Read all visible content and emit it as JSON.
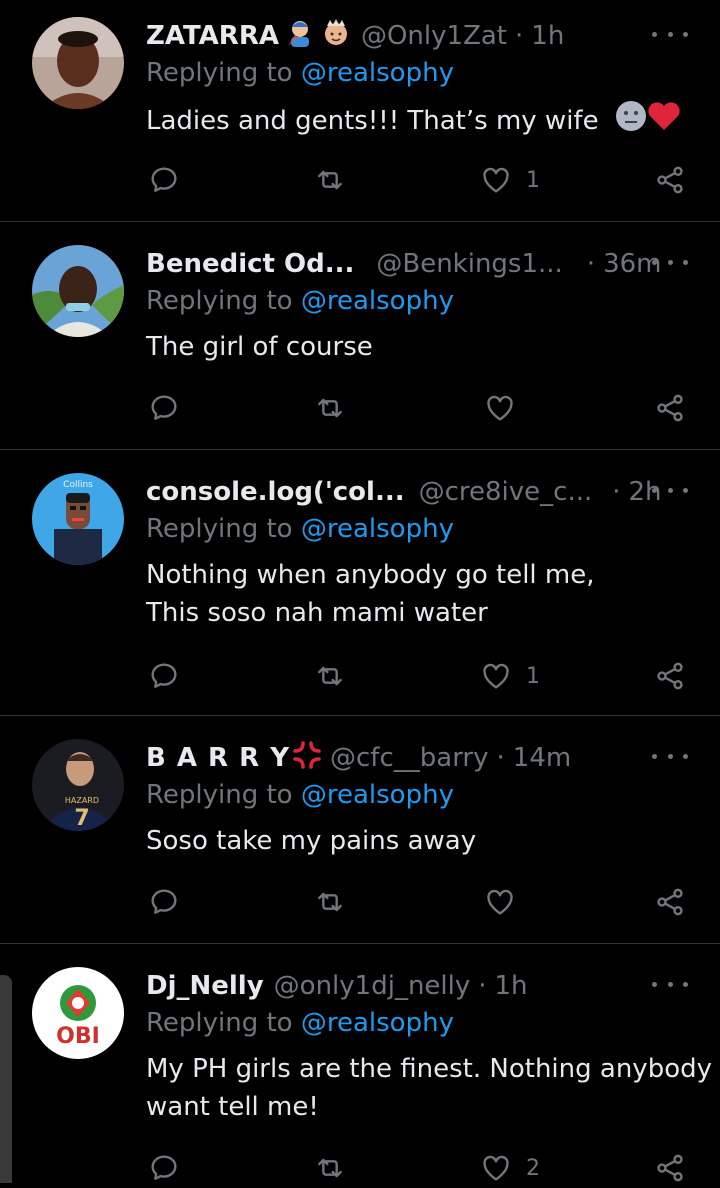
{
  "replying_label": "Replying to ",
  "tweets": [
    {
      "name": "ZATARRA",
      "handle": "@Only1Zat",
      "time": "1h",
      "mention": "@realsophy",
      "lines": [
        "Ladies and gents!!! That’s my wife"
      ],
      "likes": "1"
    },
    {
      "name": "Benedict Od...",
      "handle": "@Benkings1...",
      "time": "36m",
      "mention": "@realsophy",
      "lines": [
        "The girl of course"
      ],
      "likes": ""
    },
    {
      "name": "console.log('col...",
      "handle": "@cre8ive_c...",
      "time": "2h",
      "mention": "@realsophy",
      "lines": [
        "Nothing when anybody go tell me,",
        "This soso nah mami water"
      ],
      "likes": "1"
    },
    {
      "name": "B A R R Y",
      "handle": "@cfc__barry",
      "time": "14m",
      "mention": "@realsophy",
      "lines": [
        "Soso take my pains away"
      ],
      "likes": ""
    },
    {
      "name": "Dj_Nelly",
      "handle": "@only1dj_nelly",
      "time": "1h",
      "mention": "@realsophy",
      "lines": [
        "My PH girls are the finest. Nothing anybody",
        "want tell me!"
      ],
      "likes": "2"
    }
  ],
  "avatars": {
    "collins_label": "Collins",
    "hazard_label": "HAZARD",
    "hazard_number": "7",
    "obi_label": "OBI"
  },
  "colors": {
    "background": "#000000",
    "text": "#e7e9ea",
    "muted": "#71767b",
    "link": "#1d9bf0",
    "divider": "#2f3336"
  }
}
